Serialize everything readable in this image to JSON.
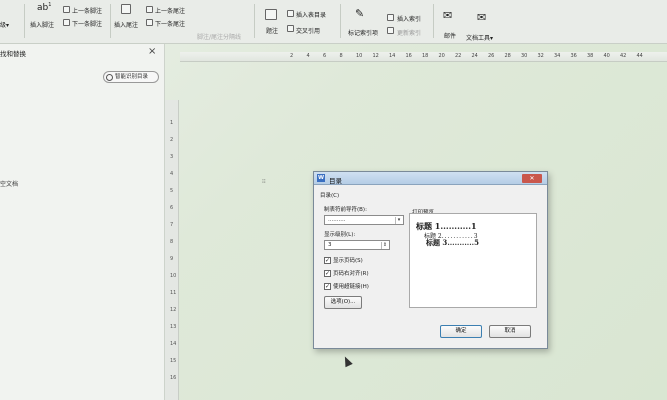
{
  "ribbon": {
    "left_partial": "级▾",
    "insert_footnote": "插入脚注",
    "prev_footnote": "上一条脚注",
    "next_footnote": "下一条脚注",
    "insert_endnote": "插入尾注",
    "prev_endnote": "上一条尾注",
    "next_endnote": "下一条尾注",
    "footnote_separator": "脚注/尾注分隔线",
    "note": "题注",
    "insert_caption": "插入表目录",
    "cross_reference": "交叉引用",
    "mark_index": "标记索引项",
    "insert_index": "插入索引",
    "update_index": "更新索引",
    "mail": "邮件",
    "dev_tools": "文档工具▾"
  },
  "navpane": {
    "title": "找和替换",
    "close": "×",
    "smart_toc_button": "智能识别目录",
    "blank_text": "空文档"
  },
  "ruler": {
    "h_ticks": [
      "2",
      "4",
      "6",
      "8",
      "10",
      "12",
      "14",
      "16",
      "18",
      "20",
      "22",
      "24",
      "26",
      "28",
      "30",
      "32",
      "34",
      "36",
      "38",
      "40",
      "42",
      "44"
    ],
    "v_ticks": [
      "1",
      "2",
      "3",
      "4",
      "5",
      "6",
      "7",
      "8",
      "9",
      "10",
      "11",
      "12",
      "13",
      "14",
      "15",
      "16"
    ]
  },
  "dialog": {
    "icon_letter": "W",
    "title": "目录",
    "close": "✕",
    "group_label": "目录(C)",
    "leader_label": "制表符前导符(B):",
    "leader_value": "..........",
    "levels_label": "显示级别(L):",
    "levels_value": "3",
    "show_page_numbers": "显示页码(S)",
    "right_align_page_numbers": "页码右对齐(R)",
    "use_hyperlinks": "使用超链接(H)",
    "options_button": "选项(O)...",
    "preview_label": "打印预览",
    "toc_entries": [
      {
        "text": "标题 1",
        "dots": "...........",
        "page": "1"
      },
      {
        "text": "标题 2",
        "dots": "...........",
        "page": "3"
      },
      {
        "text": "标题 3",
        "dots": "...........",
        "page": "5"
      }
    ],
    "ok_button": "确定",
    "cancel_button": "取消"
  }
}
